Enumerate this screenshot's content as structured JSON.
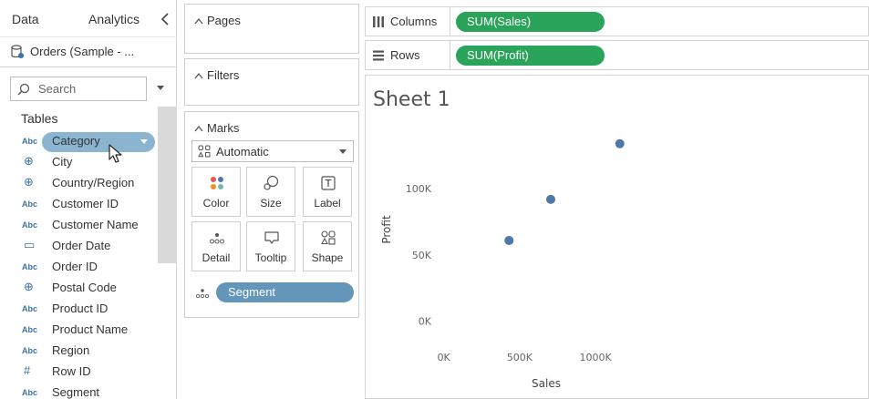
{
  "data_pane": {
    "tab_data": "Data",
    "tab_analytics": "Analytics",
    "datasource": "Orders (Sample - ...",
    "search_placeholder": "Search",
    "tables_label": "Tables",
    "fields": [
      {
        "type": "Abc",
        "label": "Category"
      },
      {
        "type": "geo",
        "label": "City"
      },
      {
        "type": "geo",
        "label": "Country/Region"
      },
      {
        "type": "Abc",
        "label": "Customer ID"
      },
      {
        "type": "Abc",
        "label": "Customer Name"
      },
      {
        "type": "cal",
        "label": "Order Date"
      },
      {
        "type": "Abc",
        "label": "Order ID"
      },
      {
        "type": "geo",
        "label": "Postal Code"
      },
      {
        "type": "Abc",
        "label": "Product ID"
      },
      {
        "type": "Abc",
        "label": "Product Name"
      },
      {
        "type": "Abc",
        "label": "Region"
      },
      {
        "type": "hash",
        "label": "Row ID"
      },
      {
        "type": "Abc",
        "label": "Segment"
      }
    ],
    "type_abc_text": "Abc",
    "type_geo_glyph": "⊕",
    "type_cal_glyph": "▭",
    "type_hash_glyph": "#"
  },
  "cards": {
    "pages_title": "Pages",
    "filters_title": "Filters",
    "marks_title": "Marks",
    "mark_type": "Automatic",
    "buttons": {
      "color": "Color",
      "size": "Size",
      "label": "Label",
      "detail": "Detail",
      "tooltip": "Tooltip",
      "shape": "Shape"
    },
    "detail_pill": "Segment"
  },
  "shelves": {
    "columns_label": "Columns",
    "columns_pill": "SUM(Sales)",
    "rows_label": "Rows",
    "rows_pill": "SUM(Profit)"
  },
  "view": {
    "sheet_title": "Sheet 1"
  },
  "colors": {
    "measure_pill": "#2aa45a",
    "dimension_pill": "#6496b9",
    "selected_field": "#8ab4cf",
    "mark": "#4e79a7"
  },
  "chart_data": {
    "type": "scatter",
    "title": "Sheet 1",
    "xlabel": "Sales",
    "ylabel": "Profit",
    "xlim": [
      -250000,
      1450000
    ],
    "ylim": [
      -25000,
      160000
    ],
    "x_ticks": [
      0,
      500000,
      1000000
    ],
    "x_tick_labels": [
      "0K",
      "500K",
      "1000K"
    ],
    "y_ticks": [
      0,
      50000,
      100000
    ],
    "y_tick_labels": [
      "0K",
      "50K",
      "100K"
    ],
    "points": [
      {
        "x": 430000,
        "y": 61000
      },
      {
        "x": 705000,
        "y": 92000
      },
      {
        "x": 1160000,
        "y": 134000
      }
    ],
    "grid": false
  }
}
